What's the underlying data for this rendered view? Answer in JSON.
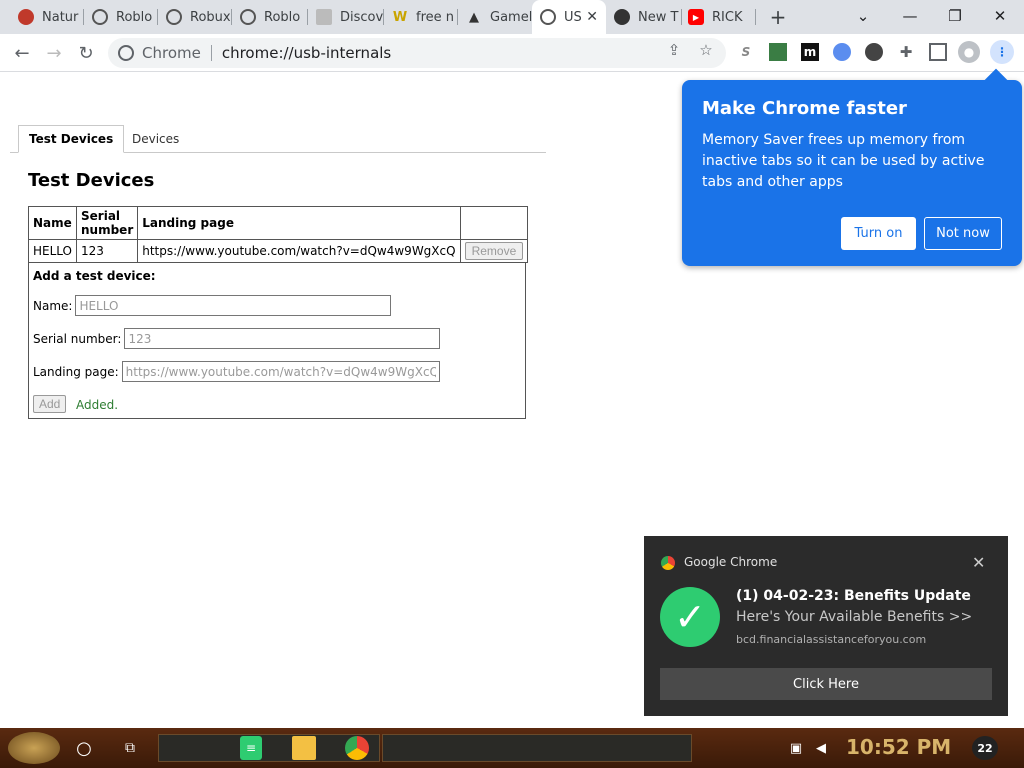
{
  "browser": {
    "tabs": [
      {
        "title": "Natur",
        "icon_color": "#c0392b"
      },
      {
        "title": "Roblo",
        "icon_color": "#555555"
      },
      {
        "title": "Robux",
        "icon_color": "#555555"
      },
      {
        "title": "Roblo",
        "icon_color": "#555555"
      },
      {
        "title": "Discov",
        "icon_color": "#999999"
      },
      {
        "title": "free n",
        "icon_color": "#f1c40f"
      },
      {
        "title": "Gamel",
        "icon_color": "#333333"
      },
      {
        "title": "US",
        "icon_color": "#555555",
        "active": true
      },
      {
        "title": "New T",
        "icon_color": "#333333"
      },
      {
        "title": "RICK",
        "icon_color": "#ff0000"
      }
    ],
    "new_tab_label": "+",
    "omnibox": {
      "chip": "Chrome",
      "url": "chrome://usb-internals"
    }
  },
  "page": {
    "tabs": [
      "Test Devices",
      "Devices"
    ],
    "heading": "Test Devices",
    "table": {
      "headers": [
        "Name",
        "Serial number",
        "Landing page",
        ""
      ],
      "rows": [
        {
          "name": "HELLO",
          "serial": "123",
          "landing": "https://www.youtube.com/watch?v=dQw4w9WgXcQ",
          "action": "Remove"
        }
      ]
    },
    "add_form": {
      "title": "Add a test device:",
      "name_label": "Name:",
      "name_value": "HELLO",
      "serial_label": "Serial number:",
      "serial_value": "123",
      "landing_label": "Landing page:",
      "landing_value": "https://www.youtube.com/watch?v=dQw4w9WgXcQ",
      "add_label": "Add",
      "status": "Added."
    }
  },
  "promo": {
    "title": "Make Chrome faster",
    "body": "Memory Saver frees up memory from inactive tabs so it can be used by active tabs and other apps",
    "turn_on": "Turn on",
    "not_now": "Not now"
  },
  "notification": {
    "app": "Google Chrome",
    "title": "(1) 04-02-23: Benefits Update",
    "subtitle": "Here's Your Available Benefits >>",
    "source": "bcd.financialassistanceforyou.com",
    "button": "Click Here"
  },
  "taskbar": {
    "clock": "10:52 PM",
    "notification_count": "22"
  }
}
